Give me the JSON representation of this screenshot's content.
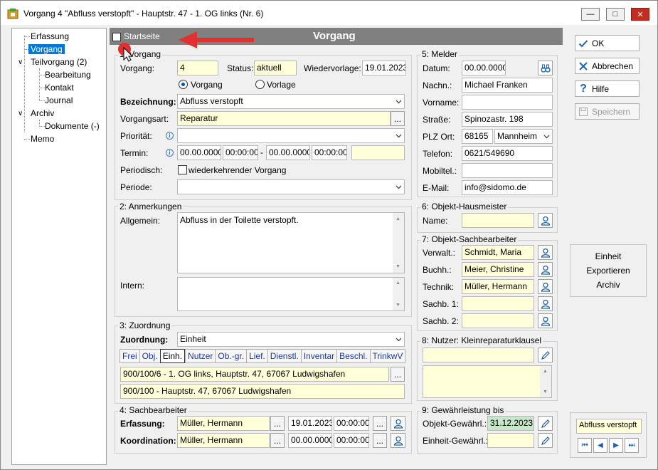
{
  "window": {
    "title": "Vorgang 4 \"Abfluss verstopft\" - Hauptstr. 47 - 1. OG links (Nr. 6)"
  },
  "tree": {
    "items": [
      "Erfassung",
      "Vorgang",
      "Teilvorgang (2)",
      "Bearbeitung",
      "Kontakt",
      "Journal",
      "Archiv",
      "Dokumente (-)",
      "Memo"
    ]
  },
  "header": {
    "title": "Vorgang",
    "checkbox_label": "Startseite"
  },
  "vorgang": {
    "group": "1: Vorgang",
    "vorgang_label": "Vorgang:",
    "vorgang_value": "4",
    "status_label": "Status:",
    "status_value": "aktuell",
    "wiedervorlage_label": "Wiedervorlage:",
    "wiedervorlage_value": "19.01.2023",
    "radio_vorgang": "Vorgang",
    "radio_vorlage": "Vorlage",
    "bezeichnung_label": "Bezeichnung:",
    "bezeichnung_value": "Abfluss verstopft",
    "vorgangsart_label": "Vorgangsart:",
    "vorgangsart_value": "Reparatur",
    "prioritaet_label": "Priorität:",
    "termin_label": "Termin:",
    "termin_date1": "00.00.0000",
    "termin_time1": "00:00:00",
    "termin_dash": "-",
    "termin_date2": "00.00.0000",
    "termin_time2": "00:00:00",
    "periodisch_label": "Periodisch:",
    "periodisch_cb": "wiederkehrender Vorgang",
    "periode_label": "Periode:",
    "ellipsis": "..."
  },
  "anmerkungen": {
    "group": "2: Anmerkungen",
    "allgemein_label": "Allgemein:",
    "allgemein_value": "Abfluss in der Toilette verstopft.",
    "intern_label": "Intern:"
  },
  "zuordnung": {
    "group": "3: Zuordnung",
    "label": "Zuordnung:",
    "value": "Einheit",
    "tabs": [
      "Frei",
      "Obj.",
      "Einh.",
      "Nutzer",
      "Ob.-gr.",
      "Lief.",
      "Dienstl.",
      "Inventar",
      "Beschl.",
      "TrinkwV"
    ],
    "line1": "900/100/6 - 1. OG links, Hauptstr. 47, 67067 Ludwigshafen",
    "line2": "900/100 - Hauptstr. 47, 67067 Ludwigshafen"
  },
  "sachbearbeiter": {
    "group": "4: Sachbearbeiter",
    "erfassung_label": "Erfassung:",
    "erfassung_name": "Müller, Hermann",
    "erfassung_date": "19.01.2023",
    "erfassung_time": "00:00:00",
    "koordination_label": "Koordination:",
    "koordination_name": "Müller, Hermann",
    "koordination_date": "00.00.0000",
    "koordination_time": "00:00:00"
  },
  "melder": {
    "group": "5: Melder",
    "datum_label": "Datum:",
    "datum_value": "00.00.0000",
    "nachn_label": "Nachn.:",
    "nachn_value": "Michael Franken",
    "vorname_label": "Vorname:",
    "strasse_label": "Straße:",
    "strasse_value": "Spinozastr. 198",
    "plz_label": "PLZ Ort:",
    "plz_value": "68165",
    "ort_value": "Mannheim",
    "telefon_label": "Telefon:",
    "telefon_value": "0621/549690",
    "mobil_label": "Mobiltel.:",
    "email_label": "E-Mail:",
    "email_value": "info@sidomo.de"
  },
  "hausmeister": {
    "group": "6: Objekt-Hausmeister",
    "name_label": "Name:"
  },
  "objektsachbearbeiter": {
    "group": "7: Objekt-Sachbearbeiter",
    "verwalt_label": "Verwalt.:",
    "verwalt_value": "Schmidt, Maria",
    "buchh_label": "Buchh.:",
    "buchh_value": "Meier, Christine",
    "technik_label": "Technik:",
    "technik_value": "Müller, Hermann",
    "sachb1_label": "Sachb. 1:",
    "sachb2_label": "Sachb. 2:"
  },
  "nutzer": {
    "group": "8: Nutzer: Kleinreparaturklausel"
  },
  "gewaehrleistung": {
    "group": "9: Gewährleistung bis",
    "objekt_label": "Objekt-Gewährl.:",
    "objekt_value": "31.12.2023",
    "einheit_label": "Einheit-Gewährl.:"
  },
  "actions": {
    "ok": "OK",
    "abbrechen": "Abbrechen",
    "hilfe": "Hilfe",
    "speichern": "Speichern"
  },
  "export_panel": {
    "line1": "Einheit",
    "line2": "Exportieren",
    "line3": "Archiv"
  },
  "nav_panel": {
    "label": "Abfluss verstopft"
  },
  "colors": {
    "accent": "#0078d7",
    "header": "#808080",
    "yellow_field": "#ffffd9",
    "green_field": "#c8e6c8",
    "close": "#c42b1c",
    "arrow": "#e03030"
  }
}
